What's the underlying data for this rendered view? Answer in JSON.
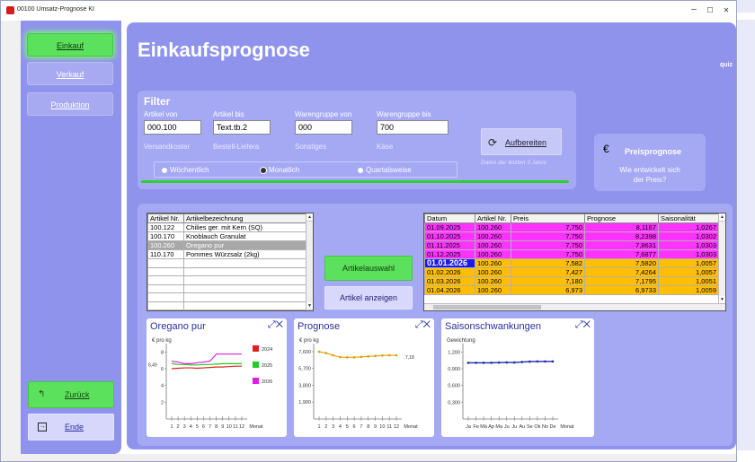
{
  "window": {
    "title": "00100 Umsatz-Prognose KI",
    "min": "–",
    "max": "☐",
    "close": "✕"
  },
  "nav": {
    "einkauf": "Einkauf",
    "verkauf": "Verkauf",
    "produktion": "Produktion",
    "zurueck": "Zurück",
    "ende": "Ende"
  },
  "page": {
    "title": "Einkaufsprognose",
    "quiz": "quiz"
  },
  "filter": {
    "title": "Filter",
    "labels": {
      "artikel_von": "Artikel von",
      "artikel_bis": "Artikel bis",
      "wg_von": "Warengruppe von",
      "wg_bis": "Warengruppe bis"
    },
    "values": {
      "artikel_von": "000.100",
      "artikel_bis": "Text.tb.2",
      "wg_von": "000",
      "wg_bis": "700"
    },
    "sub": {
      "artikel_von": "Versandkoster",
      "artikel_bis": "Bestell-Liefera",
      "wg_von": "Sonstiges",
      "wg_bis": "Käse"
    },
    "radios": {
      "w": "Wöchentlich",
      "m": "Monatlich",
      "q": "Quartalsweise",
      "selected": "m"
    },
    "aufbereiten": "Aufbereiten",
    "hint": "Daten der letzten 3 Jahre"
  },
  "preis": {
    "title": "Preisprognose",
    "line1": "Wie entwickelt sich",
    "line2": "der Preis?"
  },
  "articles": {
    "headers": [
      "Artikel Nr.",
      "Artikelbezeichnung"
    ],
    "rows": [
      {
        "nr": "100.122",
        "name": "Chilies ger. mit Kern (SQ)"
      },
      {
        "nr": "100.170",
        "name": "Knoblauch Granulat"
      },
      {
        "nr": "100.260",
        "name": "Oregano pur"
      },
      {
        "nr": "110.170",
        "name": "Pommes Würzsalz (2kg)"
      }
    ],
    "selected_index": 2
  },
  "buttons": {
    "artikelauswahl": "Artikelauswahl",
    "artikel_anzeigen": "Artikel anzeigen"
  },
  "forecast": {
    "headers": [
      "Datum",
      "Artikel Nr.",
      "Preis",
      "Prognose",
      "Saisonalität"
    ],
    "rows": [
      {
        "d": "01.09.2025",
        "a": "100.260",
        "p": "7,750",
        "g": "8,1167",
        "s": "1,0267",
        "kind": "hist"
      },
      {
        "d": "01.10.2025",
        "a": "100.260",
        "p": "7,750",
        "g": "8,2398",
        "s": "1,0302",
        "kind": "hist"
      },
      {
        "d": "01.11.2025",
        "a": "100.260",
        "p": "7,750",
        "g": "7,8631",
        "s": "1,0303",
        "kind": "hist"
      },
      {
        "d": "01.12.2025",
        "a": "100.260",
        "p": "7,750",
        "g": "7,6877",
        "s": "1,0303",
        "kind": "hist"
      },
      {
        "d": "01.01.2026",
        "a": "100.260",
        "p": "7,582",
        "g": "7,5820",
        "s": "1,0057",
        "kind": "current"
      },
      {
        "d": "01.02.2026",
        "a": "100.260",
        "p": "7,427",
        "g": "7,4264",
        "s": "1,0057",
        "kind": "fc"
      },
      {
        "d": "01.03.2026",
        "a": "100.260",
        "p": "7,180",
        "g": "7,1795",
        "s": "1,0051",
        "kind": "fc"
      },
      {
        "d": "01.04.2026",
        "a": "100.260",
        "p": "6,973",
        "g": "6,9733",
        "s": "1,0059",
        "kind": "fc"
      }
    ]
  },
  "charts": {
    "c1": {
      "title": "Oregano pur",
      "unit": "€ pro kg",
      "yticks": [
        "8",
        "6",
        "4",
        "2"
      ],
      "marker": "6,49",
      "xlabels": [
        "1",
        "2",
        "3",
        "4",
        "5",
        "6",
        "7",
        "8",
        "9",
        "10",
        "11",
        "12"
      ],
      "xname": "Monat",
      "legend": [
        {
          "name": "2024",
          "color": "#e02020"
        },
        {
          "name": "2025",
          "color": "#22cc22"
        },
        {
          "name": "2026",
          "color": "#e020e0"
        }
      ]
    },
    "c2": {
      "title": "Prognose",
      "unit": "€ pro kg",
      "yticks": [
        "7,600",
        "5,700",
        "3,800",
        "1,900"
      ],
      "endvalue": "7,18",
      "xlabels": [
        "1",
        "2",
        "3",
        "4",
        "5",
        "6",
        "7",
        "8",
        "9",
        "10",
        "11",
        "12"
      ],
      "xname": "Monat"
    },
    "c3": {
      "title": "Saisonschwankungen",
      "unit": "Gewichtung",
      "yticks": [
        "1,200",
        "0,900",
        "0,600",
        "0,300"
      ],
      "xlabels": [
        "Ja",
        "Fe",
        "Mä",
        "Ap",
        "Ma",
        "Ju",
        "Ju",
        "Au",
        "Se",
        "Ok",
        "No",
        "De"
      ],
      "xname": "Monat"
    }
  },
  "chart_data": [
    {
      "type": "line",
      "title": "Oregano pur",
      "ylabel": "€ pro kg",
      "xlabel": "Monat",
      "ylim": [
        0,
        9
      ],
      "x": [
        1,
        2,
        3,
        4,
        5,
        6,
        7,
        8,
        9,
        10,
        11,
        12
      ],
      "series": [
        {
          "name": "2024",
          "values": [
            6.0,
            6.05,
            6.1,
            6.1,
            6.05,
            6.1,
            6.15,
            6.2,
            6.2,
            6.25,
            6.3,
            6.3
          ]
        },
        {
          "name": "2025",
          "values": [
            6.6,
            6.5,
            6.5,
            6.45,
            6.45,
            6.5,
            6.5,
            6.55,
            6.6,
            6.6,
            6.6,
            6.6
          ]
        },
        {
          "name": "2026",
          "values": [
            6.9,
            6.8,
            6.6,
            6.6,
            6.7,
            6.8,
            6.9,
            7.75,
            7.75,
            7.75,
            7.75,
            7.75
          ]
        }
      ]
    },
    {
      "type": "line",
      "title": "Prognose",
      "ylabel": "€ pro kg",
      "xlabel": "Monat",
      "ylim": [
        0,
        8.5
      ],
      "x": [
        1,
        2,
        3,
        4,
        5,
        6,
        7,
        8,
        9,
        10,
        11,
        12
      ],
      "series": [
        {
          "values": [
            7.58,
            7.43,
            7.18,
            6.97,
            6.95,
            6.95,
            7.0,
            7.05,
            7.1,
            7.15,
            7.18,
            7.18
          ]
        }
      ]
    },
    {
      "type": "line",
      "title": "Saisonschwankungen",
      "ylabel": "Gewichtung",
      "xlabel": "Monat",
      "ylim": [
        0,
        1.35
      ],
      "x": [
        "Ja",
        "Fe",
        "Mä",
        "Ap",
        "Ma",
        "Ju",
        "Ju",
        "Au",
        "Se",
        "Ok",
        "No",
        "De"
      ],
      "series": [
        {
          "values": [
            1.0057,
            1.0057,
            1.0051,
            1.0059,
            1.01,
            1.012,
            1.012,
            1.02,
            1.027,
            1.03,
            1.03,
            1.03
          ]
        }
      ]
    }
  ],
  "colors": {
    "hist": "#ff33ff",
    "current": "#1a1ae6",
    "fc": "#ffbf00",
    "panel": "#8f93ec",
    "subpanel": "#a5a8f3",
    "green": "#5be15b",
    "blue_line": "#1c2aa8",
    "orange_line": "#e0a000"
  }
}
